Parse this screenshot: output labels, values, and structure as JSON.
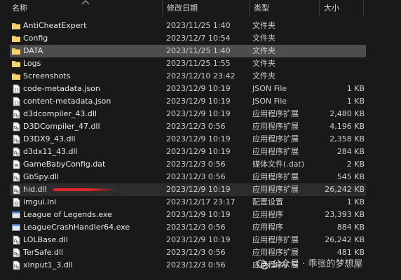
{
  "columns": {
    "name": "名称",
    "date": "修改日期",
    "type": "类型",
    "size": "大小"
  },
  "files": [
    {
      "name": "AntiCheatExpert",
      "date": "2023/11/25 1:40",
      "type": "文件夹",
      "size": "",
      "icon": "folder-icon"
    },
    {
      "name": "Config",
      "date": "2023/12/7 10:54",
      "type": "文件夹",
      "size": "",
      "icon": "folder-icon"
    },
    {
      "name": "DATA",
      "date": "2023/11/25 1:40",
      "type": "文件夹",
      "size": "",
      "icon": "folder-icon"
    },
    {
      "name": "Logs",
      "date": "2023/11/25 1:55",
      "type": "文件夹",
      "size": "",
      "icon": "folder-icon"
    },
    {
      "name": "Screenshots",
      "date": "2023/12/10 23:42",
      "type": "文件夹",
      "size": "",
      "icon": "folder-icon"
    },
    {
      "name": "code-metadata.json",
      "date": "2023/12/9 10:19",
      "type": "JSON File",
      "size": "1 KB",
      "icon": "json-file-icon"
    },
    {
      "name": "content-metadata.json",
      "date": "2023/12/9 10:19",
      "type": "JSON File",
      "size": "1 KB",
      "icon": "json-file-icon"
    },
    {
      "name": "d3dcompiler_43.dll",
      "date": "2023/12/9 10:19",
      "type": "应用程序扩展",
      "size": "2,480 KB",
      "icon": "dll-file-icon"
    },
    {
      "name": "D3DCompiler_47.dll",
      "date": "2023/12/3 0:56",
      "type": "应用程序扩展",
      "size": "4,196 KB",
      "icon": "dll-file-icon"
    },
    {
      "name": "D3DX9_43.dll",
      "date": "2023/12/9 10:19",
      "type": "应用程序扩展",
      "size": "2,358 KB",
      "icon": "dll-file-icon"
    },
    {
      "name": "d3dx11_43.dll",
      "date": "2023/12/9 10:19",
      "type": "应用程序扩展",
      "size": "284 KB",
      "icon": "dll-file-icon"
    },
    {
      "name": "GameBabyConfig.dat",
      "date": "2023/12/3 0:56",
      "type": "媒体文件(.dat)",
      "size": "2 KB",
      "icon": "dat-file-icon"
    },
    {
      "name": "GbSpy.dll",
      "date": "2023/12/3 0:56",
      "type": "应用程序扩展",
      "size": "545 KB",
      "icon": "dll-file-icon"
    },
    {
      "name": "hid.dll",
      "date": "2023/12/9 10:19",
      "type": "应用程序扩展",
      "size": "26,242 KB",
      "icon": "dll-file-icon"
    },
    {
      "name": "imgui.ini",
      "date": "2023/12/17 23:17",
      "type": "配置设置",
      "size": "1 KB",
      "icon": "ini-file-icon"
    },
    {
      "name": "League of Legends.exe",
      "date": "2023/12/9 10:19",
      "type": "应用程序",
      "size": "23,393 KB",
      "icon": "exe-file-icon"
    },
    {
      "name": "LeagueCrashHandler64.exe",
      "date": "2023/12/3 0:56",
      "type": "应用程序",
      "size": "884 KB",
      "icon": "exe-file-icon"
    },
    {
      "name": "LOLBase.dll",
      "date": "2023/12/9 10:19",
      "type": "应用程序扩展",
      "size": "26,242 KB",
      "icon": "dll-file-icon"
    },
    {
      "name": "TerSafe.dll",
      "date": "2023/12/3 0:56",
      "type": "应用程序扩展",
      "size": "481 KB",
      "icon": "dll-file-icon"
    },
    {
      "name": "xinput1_3.dll",
      "date": "2023/12/3 0:56",
      "type": "应用程序扩展",
      "size": "",
      "icon": "dll-file-icon"
    }
  ],
  "selected_index": 2,
  "hover_index": 13,
  "watermark": "公众号 · 乖张的梦想屋",
  "colors": {
    "background": "#191919",
    "selected_row": "#4d4d4d",
    "hover_row": "#2c2c2c",
    "folder": "#f2c64d",
    "highlight_mark": "#e0262b"
  }
}
